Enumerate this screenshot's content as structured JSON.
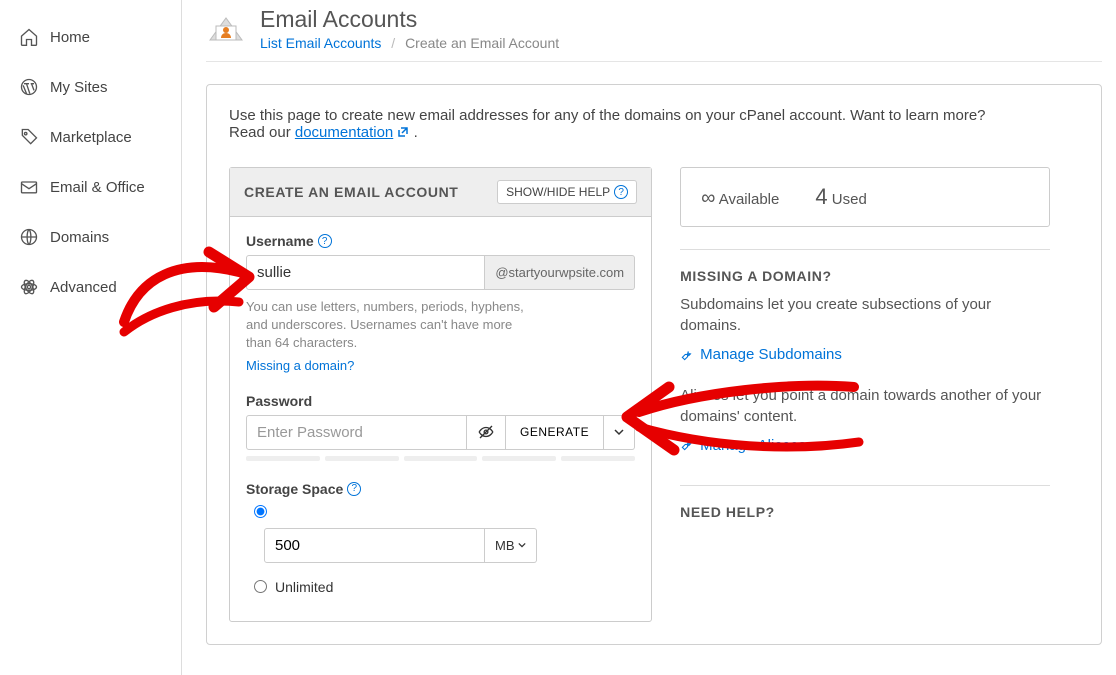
{
  "sidebar": {
    "items": [
      {
        "label": "Home"
      },
      {
        "label": "My Sites"
      },
      {
        "label": "Marketplace"
      },
      {
        "label": "Email & Office"
      },
      {
        "label": "Domains"
      },
      {
        "label": "Advanced"
      }
    ]
  },
  "header": {
    "title": "Email Accounts",
    "breadcrumb_link": "List Email Accounts",
    "breadcrumb_current": "Create an Email Account"
  },
  "intro": {
    "text_a": "Use this page to create new email addresses for any of the domains on your cPanel account. Want to learn more? Read our ",
    "doc_link": "documentation",
    "text_b": " ."
  },
  "form": {
    "card_title": "CREATE AN EMAIL ACCOUNT",
    "help_toggle": "SHOW/HIDE HELP",
    "username_label": "Username",
    "username_value": "sullie",
    "username_domain": "@startyourwpsite.com",
    "username_help": "You can use letters, numbers, periods, hyphens, and underscores. Usernames can't have more than 64 characters.",
    "username_missing_link": "Missing a domain?",
    "password_label": "Password",
    "password_placeholder": "Enter Password",
    "generate_label": "GENERATE",
    "storage_label": "Storage Space",
    "storage_value": "500",
    "storage_unit": "MB",
    "storage_unlimited": "Unlimited"
  },
  "stats": {
    "available_label": "Available",
    "used_count": "4",
    "used_label": "Used"
  },
  "missing": {
    "title": "MISSING A DOMAIN?",
    "subdomain_text": "Subdomains let you create subsections of your domains.",
    "subdomain_link": "Manage Subdomains",
    "alias_text": "Aliases let you point a domain towards another of your domains' content.",
    "alias_link": "Manage Aliases"
  },
  "help": {
    "title": "NEED HELP?"
  }
}
